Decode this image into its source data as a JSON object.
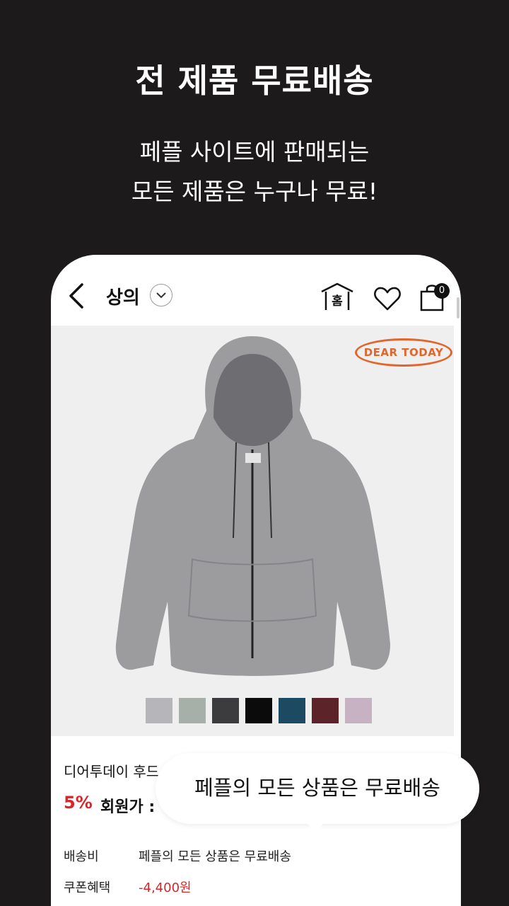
{
  "promo": {
    "headline": "전 제품 무료배송",
    "subline1": "페플 사이트에 판매되는",
    "subline2": "모든 제품은 누구나 무료!"
  },
  "topbar": {
    "title": "상의",
    "home_icon_label": "홈",
    "cart_count": "0"
  },
  "product": {
    "brand_badge": "DEAR TODAY",
    "name": "디어투데이 후드",
    "discount": "5%",
    "member_price_label": "회원가 :",
    "colors": [
      "#b5b5ba",
      "#a6b0a8",
      "#3c3c3e",
      "#0b0b0c",
      "#1d4a63",
      "#5c2428",
      "#c7b2c3"
    ]
  },
  "tooltip": {
    "text": "페플의 모든 상품은 무료배송"
  },
  "details": {
    "shipping_label": "배송비",
    "shipping_value": "페플의 모든 상품은 무료배송",
    "coupon_label": "쿠폰혜택",
    "coupon_value": "-4,400원"
  }
}
